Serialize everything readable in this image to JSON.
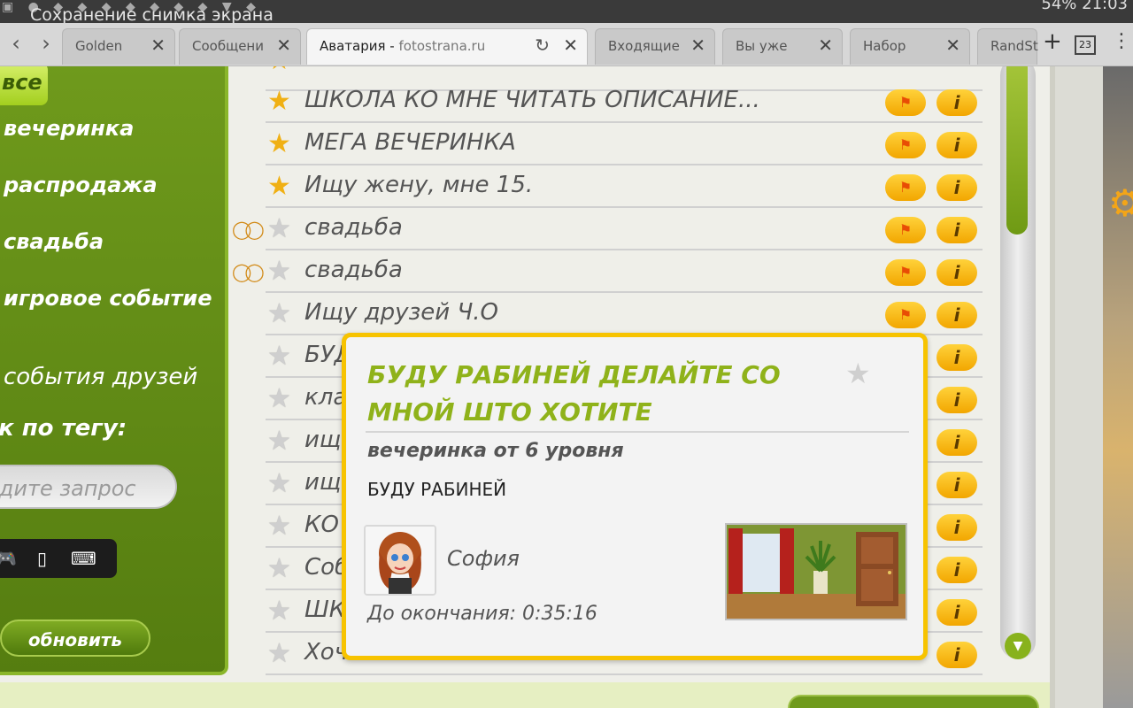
{
  "statusbar": {
    "notification": "Сохранение снимка экрана",
    "battery": "54%",
    "time": "21:03"
  },
  "tabs": [
    {
      "title": "Golden"
    },
    {
      "title": "Сообщени"
    },
    {
      "title": "Аватария",
      "domain": "fotostrana.ru",
      "active": true
    },
    {
      "title": "Входящие"
    },
    {
      "title": "Вы уже"
    },
    {
      "title": "Набор"
    },
    {
      "title": "RandSt"
    }
  ],
  "tab_count": "23",
  "sidebar": {
    "all_label": "все",
    "categories": [
      "вечеринка",
      "распродажа",
      "свадьба",
      "игровое событие"
    ],
    "friends_events": "события друзей",
    "tag_search_label": "к по тегу:",
    "search_placeholder": "едите запрос",
    "refresh_label": "обновить"
  },
  "events": [
    {
      "title": "ШКОЛА КО МНЕ ЧИТАТЬ ОПИСАНИЕ...",
      "starred": true
    },
    {
      "title": "МЕГА ВЕЧЕРИНКА",
      "starred": true
    },
    {
      "title": "Ищу жену, мне 15.",
      "starred": true
    },
    {
      "title": "свадьба",
      "starred": false,
      "wedding": true
    },
    {
      "title": "свадьба",
      "starred": false,
      "wedding": true
    },
    {
      "title": "Ищу друзей Ч.О",
      "starred": false
    },
    {
      "title": "БУД",
      "starred": false
    },
    {
      "title": "кла",
      "starred": false
    },
    {
      "title": "ищ",
      "starred": false
    },
    {
      "title": "ищ",
      "starred": false
    },
    {
      "title": "КО",
      "starred": false
    },
    {
      "title": "Соб",
      "starred": false
    },
    {
      "title": "ШК",
      "starred": false
    },
    {
      "title": "Хоч",
      "starred": false
    }
  ],
  "popup": {
    "title": "БУДУ РАБИНЕЙ ДЕЛАЙТЕ СО МНОЙ ШТО ХОТИТЕ",
    "type": "вечеринка от 6 уровня",
    "description": "БУДУ РАБИНЕЙ",
    "host_name": "София",
    "timer": "До окончания: 0:35:16"
  },
  "colors": {
    "accent_green": "#6f9a1c",
    "popup_border": "#f7c300",
    "star_gold": "#f0b014"
  }
}
